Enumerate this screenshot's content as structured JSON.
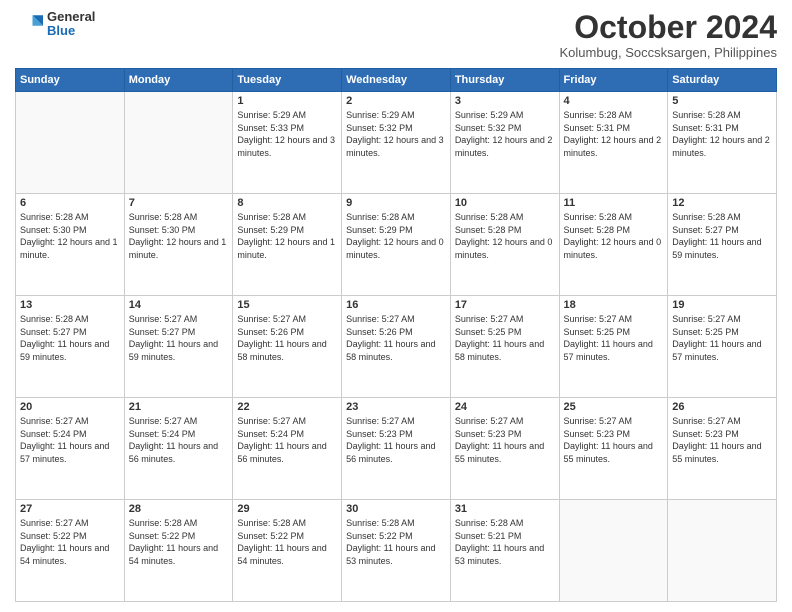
{
  "logo": {
    "general": "General",
    "blue": "Blue"
  },
  "header": {
    "month": "October 2024",
    "location": "Kolumbug, Soccsksargen, Philippines"
  },
  "days": [
    "Sunday",
    "Monday",
    "Tuesday",
    "Wednesday",
    "Thursday",
    "Friday",
    "Saturday"
  ],
  "weeks": [
    [
      {
        "day": null,
        "info": null
      },
      {
        "day": null,
        "info": null
      },
      {
        "day": "1",
        "info": "Sunrise: 5:29 AM\nSunset: 5:33 PM\nDaylight: 12 hours\nand 3 minutes."
      },
      {
        "day": "2",
        "info": "Sunrise: 5:29 AM\nSunset: 5:32 PM\nDaylight: 12 hours\nand 3 minutes."
      },
      {
        "day": "3",
        "info": "Sunrise: 5:29 AM\nSunset: 5:32 PM\nDaylight: 12 hours\nand 2 minutes."
      },
      {
        "day": "4",
        "info": "Sunrise: 5:28 AM\nSunset: 5:31 PM\nDaylight: 12 hours\nand 2 minutes."
      },
      {
        "day": "5",
        "info": "Sunrise: 5:28 AM\nSunset: 5:31 PM\nDaylight: 12 hours\nand 2 minutes."
      }
    ],
    [
      {
        "day": "6",
        "info": "Sunrise: 5:28 AM\nSunset: 5:30 PM\nDaylight: 12 hours\nand 1 minute."
      },
      {
        "day": "7",
        "info": "Sunrise: 5:28 AM\nSunset: 5:30 PM\nDaylight: 12 hours\nand 1 minute."
      },
      {
        "day": "8",
        "info": "Sunrise: 5:28 AM\nSunset: 5:29 PM\nDaylight: 12 hours\nand 1 minute."
      },
      {
        "day": "9",
        "info": "Sunrise: 5:28 AM\nSunset: 5:29 PM\nDaylight: 12 hours\nand 0 minutes."
      },
      {
        "day": "10",
        "info": "Sunrise: 5:28 AM\nSunset: 5:28 PM\nDaylight: 12 hours\nand 0 minutes."
      },
      {
        "day": "11",
        "info": "Sunrise: 5:28 AM\nSunset: 5:28 PM\nDaylight: 12 hours\nand 0 minutes."
      },
      {
        "day": "12",
        "info": "Sunrise: 5:28 AM\nSunset: 5:27 PM\nDaylight: 11 hours\nand 59 minutes."
      }
    ],
    [
      {
        "day": "13",
        "info": "Sunrise: 5:28 AM\nSunset: 5:27 PM\nDaylight: 11 hours\nand 59 minutes."
      },
      {
        "day": "14",
        "info": "Sunrise: 5:27 AM\nSunset: 5:27 PM\nDaylight: 11 hours\nand 59 minutes."
      },
      {
        "day": "15",
        "info": "Sunrise: 5:27 AM\nSunset: 5:26 PM\nDaylight: 11 hours\nand 58 minutes."
      },
      {
        "day": "16",
        "info": "Sunrise: 5:27 AM\nSunset: 5:26 PM\nDaylight: 11 hours\nand 58 minutes."
      },
      {
        "day": "17",
        "info": "Sunrise: 5:27 AM\nSunset: 5:25 PM\nDaylight: 11 hours\nand 58 minutes."
      },
      {
        "day": "18",
        "info": "Sunrise: 5:27 AM\nSunset: 5:25 PM\nDaylight: 11 hours\nand 57 minutes."
      },
      {
        "day": "19",
        "info": "Sunrise: 5:27 AM\nSunset: 5:25 PM\nDaylight: 11 hours\nand 57 minutes."
      }
    ],
    [
      {
        "day": "20",
        "info": "Sunrise: 5:27 AM\nSunset: 5:24 PM\nDaylight: 11 hours\nand 57 minutes."
      },
      {
        "day": "21",
        "info": "Sunrise: 5:27 AM\nSunset: 5:24 PM\nDaylight: 11 hours\nand 56 minutes."
      },
      {
        "day": "22",
        "info": "Sunrise: 5:27 AM\nSunset: 5:24 PM\nDaylight: 11 hours\nand 56 minutes."
      },
      {
        "day": "23",
        "info": "Sunrise: 5:27 AM\nSunset: 5:23 PM\nDaylight: 11 hours\nand 56 minutes."
      },
      {
        "day": "24",
        "info": "Sunrise: 5:27 AM\nSunset: 5:23 PM\nDaylight: 11 hours\nand 55 minutes."
      },
      {
        "day": "25",
        "info": "Sunrise: 5:27 AM\nSunset: 5:23 PM\nDaylight: 11 hours\nand 55 minutes."
      },
      {
        "day": "26",
        "info": "Sunrise: 5:27 AM\nSunset: 5:23 PM\nDaylight: 11 hours\nand 55 minutes."
      }
    ],
    [
      {
        "day": "27",
        "info": "Sunrise: 5:27 AM\nSunset: 5:22 PM\nDaylight: 11 hours\nand 54 minutes."
      },
      {
        "day": "28",
        "info": "Sunrise: 5:28 AM\nSunset: 5:22 PM\nDaylight: 11 hours\nand 54 minutes."
      },
      {
        "day": "29",
        "info": "Sunrise: 5:28 AM\nSunset: 5:22 PM\nDaylight: 11 hours\nand 54 minutes."
      },
      {
        "day": "30",
        "info": "Sunrise: 5:28 AM\nSunset: 5:22 PM\nDaylight: 11 hours\nand 53 minutes."
      },
      {
        "day": "31",
        "info": "Sunrise: 5:28 AM\nSunset: 5:21 PM\nDaylight: 11 hours\nand 53 minutes."
      },
      {
        "day": null,
        "info": null
      },
      {
        "day": null,
        "info": null
      }
    ]
  ]
}
